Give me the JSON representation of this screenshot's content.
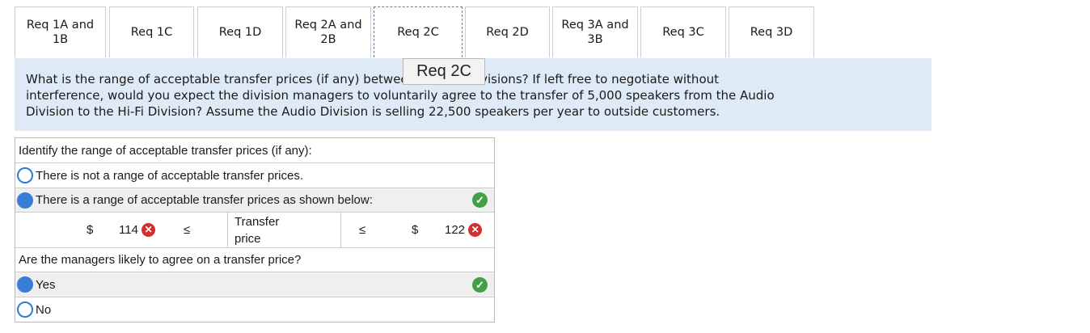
{
  "tabs": [
    {
      "label": "Req 1A and\n1B"
    },
    {
      "label": "Req 1C"
    },
    {
      "label": "Req 1D"
    },
    {
      "label": "Req 2A and\n2B"
    },
    {
      "label": "Req 2C"
    },
    {
      "label": "Req 2D"
    },
    {
      "label": "Req 3A and\n3B"
    },
    {
      "label": "Req 3C"
    },
    {
      "label": "Req 3D"
    }
  ],
  "tooltip": "Req 2C",
  "question": {
    "line1": "What is the range of acceptable transfer prices (if any) between the two divisions? If left free to negotiate without",
    "line2": "interference, would you expect the division managers to voluntarily agree to the transfer of 5,000 speakers from the Audio",
    "line3": "Division to the Hi-Fi Division? Assume the Audio Division is selling 22,500 speakers per year to outside customers."
  },
  "part1": {
    "prompt": "Identify the range of acceptable transfer prices (if any):",
    "option_none": "There is not a range of acceptable transfer prices.",
    "option_range": "There is a range of acceptable transfer prices as shown below:",
    "dollar_left": "$",
    "value_left": "114",
    "leq_left": "≤",
    "transfer_label_1": "Transfer",
    "transfer_label_2": "price",
    "leq_right": "≤",
    "dollar_right": "$",
    "value_right": "122"
  },
  "part2": {
    "prompt": "Are the managers likely to agree on a transfer price?",
    "yes": "Yes",
    "no": "No"
  },
  "icons": {
    "check": "✓",
    "cross": "✕"
  }
}
